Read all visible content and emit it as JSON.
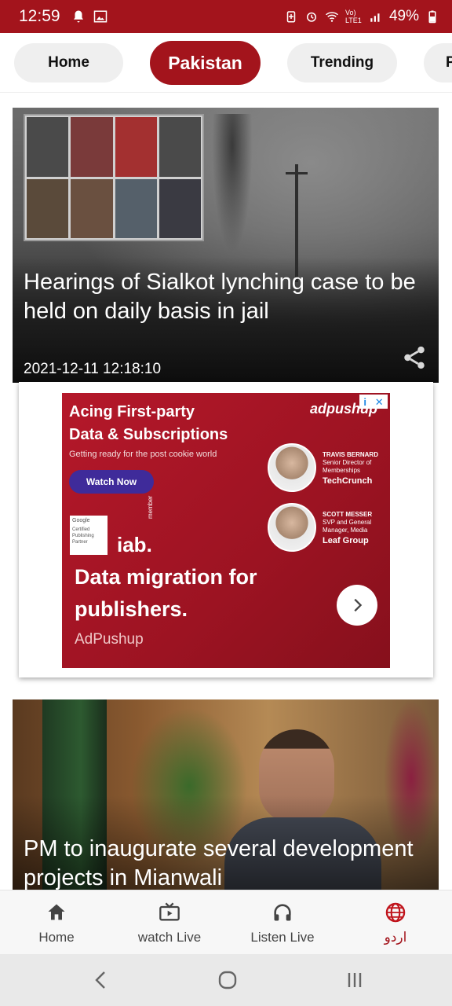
{
  "status_bar": {
    "time": "12:59",
    "battery": "49%",
    "network_label": "Vo) LTE1",
    "icons": [
      "notification-bell-icon",
      "gallery-icon",
      "battery-saver-icon",
      "alarm-icon",
      "wifi-icon",
      "signal-icon",
      "battery-icon"
    ]
  },
  "tabs": [
    {
      "label": "Home",
      "active": false
    },
    {
      "label": "Pakistan",
      "active": true
    },
    {
      "label": "Trending",
      "active": false
    },
    {
      "label": "P",
      "active": false
    }
  ],
  "feed": {
    "articles": [
      {
        "title": "Hearings of Sialkot lynching case to be held on daily basis in jail",
        "date": "2021-12-11 12:18:10",
        "share_icon": "share-icon"
      },
      {
        "title": "PM to inaugurate several development projects in Mianwali"
      }
    ],
    "ad": {
      "headline_line1": "Acing First-party",
      "headline_line2": "Data & Subscriptions",
      "subtitle": "Getting ready for the post cookie world",
      "cta": "Watch Now",
      "logo": "adpushup",
      "people": [
        {
          "name": "TRAVIS BERNARD",
          "role": "Senior Director of Memberships",
          "company": "TechCrunch"
        },
        {
          "name": "SCOTT MESSER",
          "role": "SVP and General Manager, Media",
          "company": "Leaf Group"
        }
      ],
      "badge_lines": [
        "Google",
        "Certified",
        "Publishing",
        "Partner"
      ],
      "iab": "iab.",
      "iab_member": "member",
      "big_text": "Data migration for publishers.",
      "brand": "AdPushup",
      "info_icon": "i",
      "close_icon": "✕"
    }
  },
  "bottom_nav": [
    {
      "label": "Home",
      "icon": "home-icon"
    },
    {
      "label": "watch Live",
      "icon": "tv-icon"
    },
    {
      "label": "Listen Live",
      "icon": "headphones-icon"
    },
    {
      "label": "اردو",
      "icon": "globe-icon"
    }
  ],
  "colors": {
    "brand_red": "#a3141c",
    "tab_inactive": "#efefef",
    "nav_bg": "#f7f7f7"
  }
}
